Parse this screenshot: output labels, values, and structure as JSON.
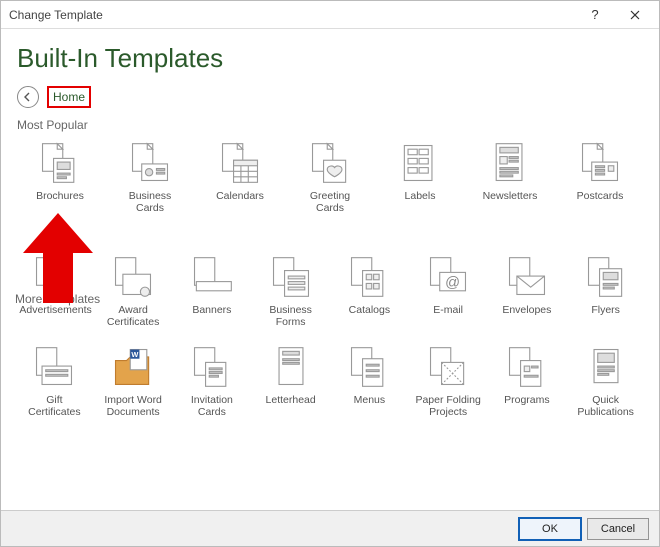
{
  "titlebar": {
    "title": "Change Template"
  },
  "page_title": "Built-In Templates",
  "nav": {
    "home": "Home"
  },
  "sections": {
    "popular": {
      "label": "Most Popular"
    },
    "more": {
      "label": "More Templates"
    }
  },
  "popular": {
    "0": {
      "label": "Brochures"
    },
    "1": {
      "label": "Business Cards"
    },
    "2": {
      "label": "Calendars"
    },
    "3": {
      "label": "Greeting Cards"
    },
    "4": {
      "label": "Labels"
    },
    "5": {
      "label": "Newsletters"
    },
    "6": {
      "label": "Postcards"
    }
  },
  "more": {
    "0": {
      "label": "Advertisements"
    },
    "1": {
      "label": "Award Certificates"
    },
    "2": {
      "label": "Banners"
    },
    "3": {
      "label": "Business Forms"
    },
    "4": {
      "label": "Catalogs"
    },
    "5": {
      "label": "E-mail"
    },
    "6": {
      "label": "Envelopes"
    },
    "7": {
      "label": "Flyers"
    },
    "8": {
      "label": "Gift Certificates"
    },
    "9": {
      "label": "Import Word Documents"
    },
    "10": {
      "label": "Invitation Cards"
    },
    "11": {
      "label": "Letterhead"
    },
    "12": {
      "label": "Menus"
    },
    "13": {
      "label": "Paper Folding Projects"
    },
    "14": {
      "label": "Programs"
    },
    "15": {
      "label": "Quick Publications"
    }
  },
  "footer": {
    "ok": "OK",
    "cancel": "Cancel"
  }
}
